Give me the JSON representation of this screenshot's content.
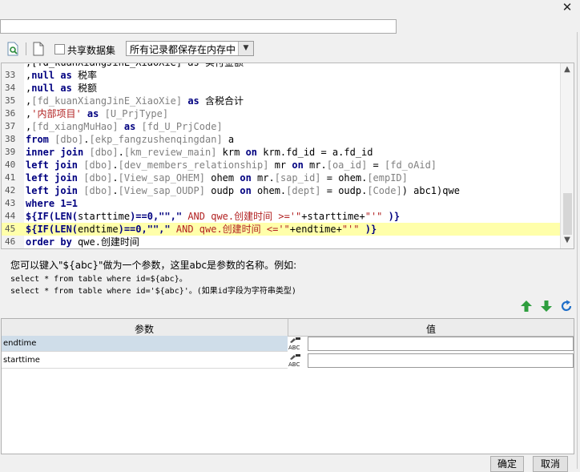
{
  "window": {
    "close_label": "✕"
  },
  "name_field": {
    "value": ""
  },
  "toolbar": {
    "share_label": "共享数据集",
    "share_checked": false,
    "mode_value": "所有记录都保存在内存中"
  },
  "editor": {
    "lines": [
      {
        "num": "",
        "tokens": [
          {
            "t": ",[fd_kuanXiangJinE_XiaoXie] as 实付金额",
            "c": "tx"
          }
        ]
      },
      {
        "num": "33",
        "tokens": [
          {
            "t": ",",
            "c": "tx"
          },
          {
            "t": "null",
            "c": "kw"
          },
          {
            "t": " ",
            "c": "tx"
          },
          {
            "t": "as",
            "c": "kw"
          },
          {
            "t": " 税率",
            "c": "tx"
          }
        ]
      },
      {
        "num": "34",
        "tokens": [
          {
            "t": ",",
            "c": "tx"
          },
          {
            "t": "null",
            "c": "kw"
          },
          {
            "t": " ",
            "c": "tx"
          },
          {
            "t": "as",
            "c": "kw"
          },
          {
            "t": " 税额",
            "c": "tx"
          }
        ]
      },
      {
        "num": "35",
        "tokens": [
          {
            "t": ",",
            "c": "tx"
          },
          {
            "t": "[fd_kuanXiangJinE_XiaoXie]",
            "c": "br"
          },
          {
            "t": " ",
            "c": "tx"
          },
          {
            "t": "as",
            "c": "kw"
          },
          {
            "t": " 含税合计",
            "c": "tx"
          }
        ]
      },
      {
        "num": "36",
        "tokens": [
          {
            "t": ",",
            "c": "tx"
          },
          {
            "t": "'内部项目'",
            "c": "st"
          },
          {
            "t": " ",
            "c": "tx"
          },
          {
            "t": "as",
            "c": "kw"
          },
          {
            "t": " ",
            "c": "tx"
          },
          {
            "t": "[U_PrjType]",
            "c": "br"
          }
        ]
      },
      {
        "num": "37",
        "tokens": [
          {
            "t": ",",
            "c": "tx"
          },
          {
            "t": "[fd_xiangMuHao]",
            "c": "br"
          },
          {
            "t": " ",
            "c": "tx"
          },
          {
            "t": "as",
            "c": "kw"
          },
          {
            "t": " ",
            "c": "tx"
          },
          {
            "t": "[fd_U_PrjCode]",
            "c": "br"
          }
        ]
      },
      {
        "num": "38",
        "tokens": [
          {
            "t": "from",
            "c": "kw"
          },
          {
            "t": " ",
            "c": "tx"
          },
          {
            "t": "[dbo]",
            "c": "br"
          },
          {
            "t": ".",
            "c": "tx"
          },
          {
            "t": "[ekp_fangzushenqingdan]",
            "c": "br"
          },
          {
            "t": " a",
            "c": "tx"
          }
        ]
      },
      {
        "num": "39",
        "tokens": [
          {
            "t": "inner join",
            "c": "kw"
          },
          {
            "t": " ",
            "c": "tx"
          },
          {
            "t": "[dbo]",
            "c": "br"
          },
          {
            "t": ".",
            "c": "tx"
          },
          {
            "t": "[km_review_main]",
            "c": "br"
          },
          {
            "t": " krm ",
            "c": "tx"
          },
          {
            "t": "on",
            "c": "kw"
          },
          {
            "t": " krm.fd_id = a.fd_id",
            "c": "tx"
          }
        ]
      },
      {
        "num": "40",
        "tokens": [
          {
            "t": "left join",
            "c": "kw"
          },
          {
            "t": " ",
            "c": "tx"
          },
          {
            "t": "[dbo]",
            "c": "br"
          },
          {
            "t": ".",
            "c": "tx"
          },
          {
            "t": "[dev_members_relationship]",
            "c": "br"
          },
          {
            "t": " mr ",
            "c": "tx"
          },
          {
            "t": "on",
            "c": "kw"
          },
          {
            "t": " mr.",
            "c": "tx"
          },
          {
            "t": "[oa_id]",
            "c": "br"
          },
          {
            "t": " = ",
            "c": "tx"
          },
          {
            "t": "[fd_oAid]",
            "c": "br"
          }
        ]
      },
      {
        "num": "41",
        "tokens": [
          {
            "t": "left join",
            "c": "kw"
          },
          {
            "t": " ",
            "c": "tx"
          },
          {
            "t": "[dbo]",
            "c": "br"
          },
          {
            "t": ".",
            "c": "tx"
          },
          {
            "t": "[View_sap_OHEM]",
            "c": "br"
          },
          {
            "t": " ohem ",
            "c": "tx"
          },
          {
            "t": "on",
            "c": "kw"
          },
          {
            "t": " mr.",
            "c": "tx"
          },
          {
            "t": "[sap_id]",
            "c": "br"
          },
          {
            "t": " = ohem.",
            "c": "tx"
          },
          {
            "t": "[empID]",
            "c": "br"
          }
        ]
      },
      {
        "num": "42",
        "tokens": [
          {
            "t": "left join",
            "c": "kw"
          },
          {
            "t": " ",
            "c": "tx"
          },
          {
            "t": "[dbo]",
            "c": "br"
          },
          {
            "t": ".",
            "c": "tx"
          },
          {
            "t": "[View_sap_OUDP]",
            "c": "br"
          },
          {
            "t": " oudp ",
            "c": "tx"
          },
          {
            "t": "on",
            "c": "kw"
          },
          {
            "t": " ohem.",
            "c": "tx"
          },
          {
            "t": "[dept]",
            "c": "br"
          },
          {
            "t": " = oudp.",
            "c": "tx"
          },
          {
            "t": "[Code]",
            "c": "br"
          },
          {
            "t": ") abc1)qwe",
            "c": "tx"
          }
        ]
      },
      {
        "num": "43",
        "tokens": [
          {
            "t": "where 1=1",
            "c": "kw"
          }
        ]
      },
      {
        "num": "44",
        "tokens": [
          {
            "t": "${IF(LEN(",
            "c": "kw"
          },
          {
            "t": "starttime",
            "c": "tx"
          },
          {
            "t": ")==0,\"\",\"",
            "c": "kw"
          },
          {
            "t": " AND qwe.创建时间 >='\"",
            "c": "st"
          },
          {
            "t": "+starttime+",
            "c": "tx"
          },
          {
            "t": "\"'\"",
            "c": "st"
          },
          {
            "t": " )}",
            "c": "kw"
          }
        ]
      },
      {
        "num": "45",
        "highlight": true,
        "tokens": [
          {
            "t": "${IF(LEN(",
            "c": "kw"
          },
          {
            "t": "endtime",
            "c": "tx"
          },
          {
            "t": ")==0,\"\",\"",
            "c": "kw"
          },
          {
            "t": " AND qwe.创建时间 <='\"",
            "c": "st"
          },
          {
            "t": "+endtime+",
            "c": "tx"
          },
          {
            "t": "\"'\"",
            "c": "st"
          },
          {
            "t": " )}",
            "c": "kw"
          }
        ]
      },
      {
        "num": "46",
        "tokens": [
          {
            "t": "order by",
            "c": "kw"
          },
          {
            "t": " qwe.创建时间",
            "c": "tx"
          }
        ]
      }
    ]
  },
  "help": {
    "line1": "您可以键入\"${abc}\"做为一个参数，这里abc是参数的名称。例如:",
    "line2": "select * from table where id=${abc}。",
    "line3": "select * from table where id='${abc}'。(如果id字段为字符串类型)"
  },
  "params": {
    "col_name": "参数",
    "col_value": "值",
    "type_icon_text": "ABC",
    "rows": [
      {
        "name": "endtime",
        "value": "",
        "selected": true
      },
      {
        "name": "starttime",
        "value": "",
        "selected": false
      }
    ]
  },
  "buttons": {
    "ok": "确定",
    "cancel": "取消"
  },
  "colors": {
    "accent_green": "#2e9e3e",
    "refresh_blue": "#1f6fc9",
    "row_selected": "#cfdde9"
  }
}
